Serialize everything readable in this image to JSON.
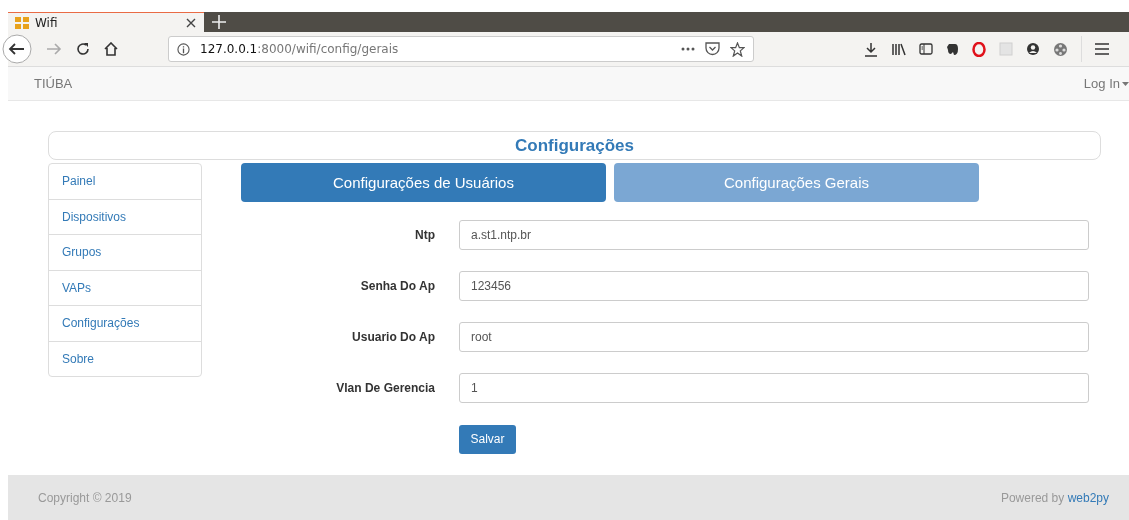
{
  "browser": {
    "tab_title": "Wifi",
    "url_host": "127.0.0.1",
    "url_path": ":8000/wifi/config/gerais"
  },
  "navbar": {
    "brand": "TIÚBA",
    "login": "Log In"
  },
  "panel_title": "Configurações",
  "sidebar": {
    "items": [
      {
        "label": "Painel"
      },
      {
        "label": "Dispositivos"
      },
      {
        "label": "Grupos"
      },
      {
        "label": "VAPs"
      },
      {
        "label": "Configurações"
      },
      {
        "label": "Sobre"
      }
    ]
  },
  "tabs": [
    {
      "label": "Configurações de Usuários",
      "selected": true
    },
    {
      "label": "Configurações Gerais",
      "selected": false
    }
  ],
  "form": {
    "fields": [
      {
        "label": "Ntp",
        "value": "a.st1.ntp.br"
      },
      {
        "label": "Senha Do Ap",
        "value": "123456"
      },
      {
        "label": "Usuario Do Ap",
        "value": "root"
      },
      {
        "label": "Vlan De Gerencia",
        "value": "1"
      }
    ],
    "submit": "Salvar"
  },
  "footer": {
    "copyright": "Copyright © 2019",
    "powered_by": "Powered by",
    "link": "web2py"
  }
}
